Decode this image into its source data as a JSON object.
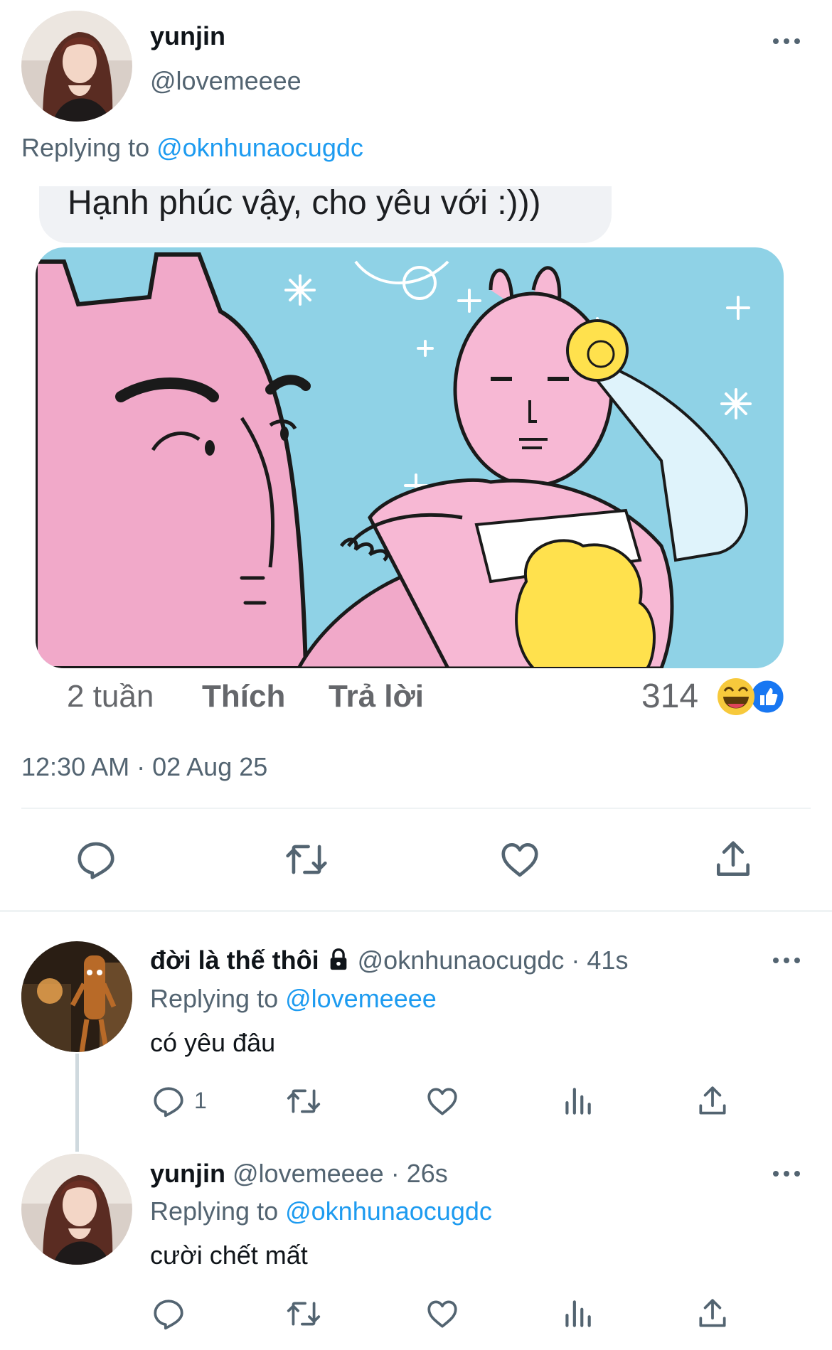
{
  "main_tweet": {
    "display_name": "yunjin",
    "handle": "@lovemeeee",
    "replying_prefix": "Replying to ",
    "replying_handle": "@oknhunaocugdc",
    "timestamp": "12:30 AM · 02 Aug 25",
    "embedded_comment": {
      "text": "Hạnh phúc vậy, cho yêu với :)))",
      "time": "2 tuần",
      "like_label": "Thích",
      "reply_label": "Trả lời",
      "reaction_count": "314"
    }
  },
  "replies": [
    {
      "display_name": "đời là thế thôi",
      "handle": "@oknhunaocugdc",
      "time": "· 41s",
      "replying_prefix": "Replying to ",
      "replying_handle": "@lovemeeee",
      "text": "có yêu đâu",
      "reply_count": "1"
    },
    {
      "display_name": "yunjin",
      "handle": "@lovemeeee",
      "time": "· 26s",
      "replying_prefix": "Replying to ",
      "replying_handle": "@oknhunaocugdc",
      "text": "cười chết mất"
    }
  ],
  "colors": {
    "link": "#1d9bf0",
    "muted": "#536471",
    "text": "#0f1419"
  },
  "icons": [
    "more-icon",
    "reply-icon",
    "retweet-icon",
    "like-icon",
    "share-icon",
    "views-icon",
    "lock-icon"
  ]
}
